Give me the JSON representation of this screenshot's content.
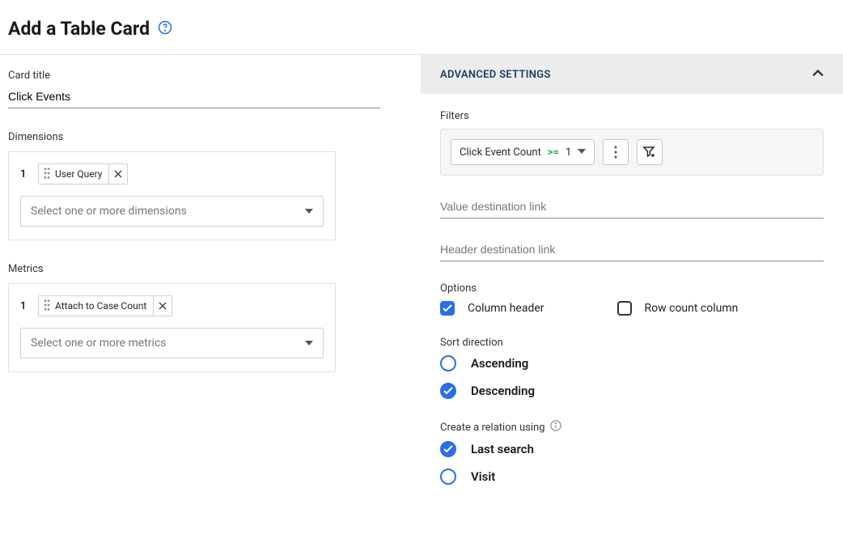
{
  "header": {
    "title": "Add a Table Card"
  },
  "card_title": {
    "label": "Card title",
    "value": "Click Events"
  },
  "dimensions": {
    "label": "Dimensions",
    "chips": [
      {
        "index": "1",
        "text": "User Query"
      }
    ],
    "placeholder": "Select one or more dimensions"
  },
  "metrics": {
    "label": "Metrics",
    "chips": [
      {
        "index": "1",
        "text": "Attach to Case Count"
      }
    ],
    "placeholder": "Select one or more metrics"
  },
  "advanced": {
    "title": "ADVANCED SETTINGS",
    "filters": {
      "label": "Filters",
      "pill_field": "Click Event Count",
      "pill_op": ">=",
      "pill_value": "1"
    },
    "value_link": {
      "label": "Value destination link",
      "value": ""
    },
    "header_link": {
      "label": "Header destination link",
      "value": ""
    },
    "options": {
      "label": "Options",
      "column_header": {
        "label": "Column header",
        "checked": true
      },
      "row_count": {
        "label": "Row count column",
        "checked": false
      }
    },
    "sort": {
      "label": "Sort direction",
      "asc": "Ascending",
      "desc": "Descending",
      "selected": "desc"
    },
    "relation": {
      "label": "Create a relation using",
      "last_search": "Last search",
      "visit": "Visit",
      "selected": "last_search"
    }
  }
}
